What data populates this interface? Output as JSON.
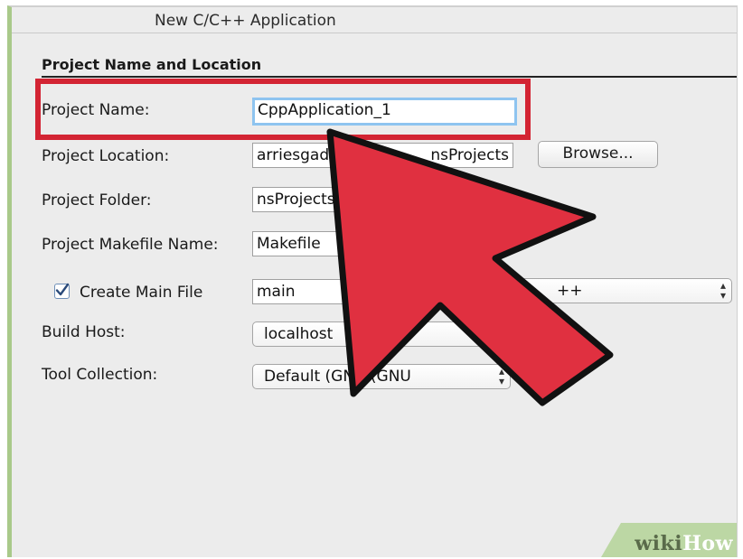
{
  "window": {
    "title": "New C/C++ Application"
  },
  "section": {
    "title": "Project Name and Location"
  },
  "form": {
    "project_name": {
      "label": "Project Name:",
      "value": "CppApplication_1"
    },
    "project_location": {
      "label": "Project Location:",
      "value": "arriesgad",
      "value_tail": "nsProjects"
    },
    "browse_button": "Browse...",
    "project_folder": {
      "label": "Project Folder:",
      "value": "nsProjects/"
    },
    "makefile": {
      "label": "Project Makefile Name:",
      "value": "Makefile"
    },
    "create_main": {
      "label": "Create Main File",
      "checked": true,
      "value": "main",
      "language_value_partial": "++"
    },
    "build_host": {
      "label": "Build Host:",
      "value": "localhost"
    },
    "tool_collection": {
      "label": "Tool Collection:",
      "value": "Default (GNU (GNU"
    }
  },
  "colors": {
    "highlight": "#d32433",
    "arrow": "#e03040",
    "focus_ring": "#8ec4f0",
    "frame_accent": "#a9c98a"
  },
  "icons": {
    "checkbox": "checkmark-icon",
    "stepper": "up-down-arrows-icon",
    "pointer": "red-arrow-icon"
  },
  "watermark": {
    "part1": "wiki",
    "part2": "How"
  }
}
